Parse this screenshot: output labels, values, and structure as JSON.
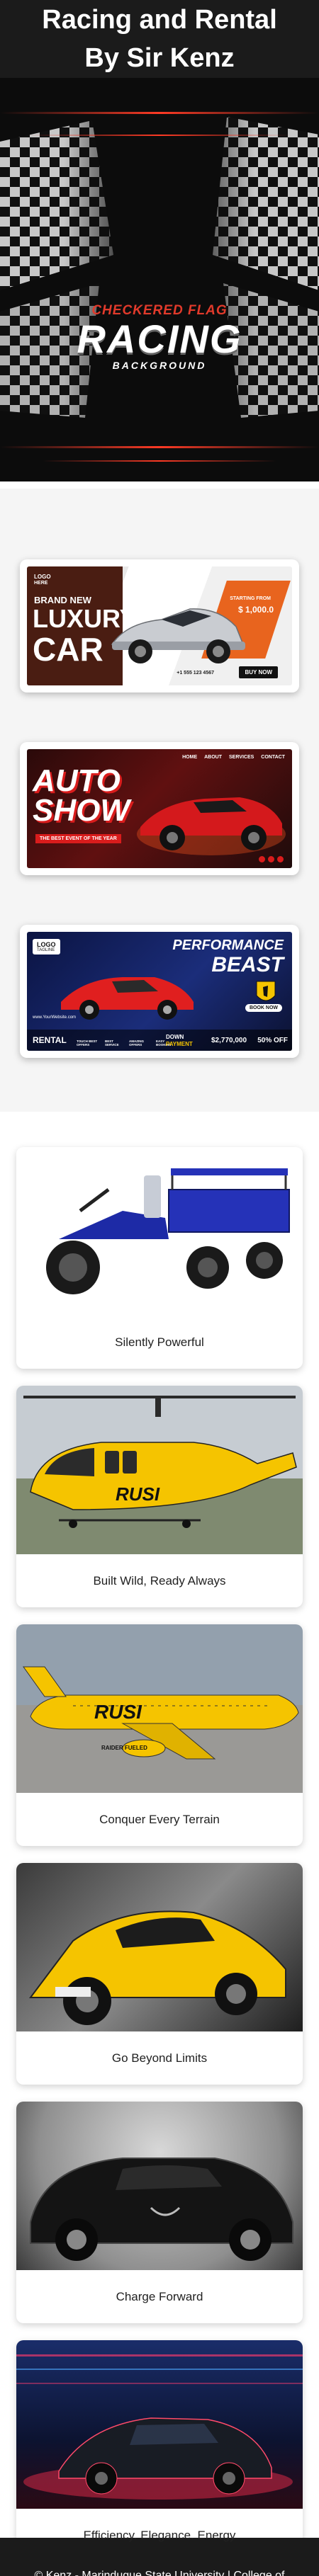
{
  "header": {
    "line1": "Racing and Rental",
    "line2": "By Sir Kenz"
  },
  "hero": {
    "top": "CHECKERED FLAG",
    "main": "RACING",
    "sub": "BACKGROUND"
  },
  "banners": [
    {
      "logo": "LOGO",
      "logo_sub": "HERE",
      "title_small": "BRAND NEW",
      "title_big1": "LUXURY",
      "title_big2": "CAR",
      "price_label": "STARTING FROM",
      "price": "$ 1,000.0",
      "phone": "+1 555 123 4567",
      "button": "BUY NOW"
    },
    {
      "title1": "AUTO",
      "title2": "SHOW",
      "tagline": "THE BEST EVENT OF THE YEAR",
      "menu": [
        "HOME",
        "ABOUT",
        "SERVICES",
        "CONTACT"
      ]
    },
    {
      "logo": "LOGO",
      "logo_sub": "TAGLINE",
      "title1": "PERFORMANCE",
      "title2": "BEAST",
      "button": "BOOK NOW",
      "website": "www.YourWebsite.com",
      "rental": "RENTAL",
      "specs": [
        "TOUCH BEST OFFERS",
        "BEST SERVICE",
        "AMAZING OFFERS",
        "EASY BOOKING"
      ],
      "down": "DOWN",
      "payment": "PAYMENT",
      "price": "$2,770,000",
      "discount": "50% OFF"
    }
  ],
  "gallery": [
    {
      "caption": "Silently Powerful",
      "subject": "motorcycle-cargo-trike"
    },
    {
      "caption": "Built Wild, Ready Always",
      "subject": "yellow-helicopter",
      "livery": "RUSI"
    },
    {
      "caption": "Conquer Every Terrain",
      "subject": "yellow-airplane",
      "livery": "RUSI",
      "sublivery": "RAIDER FUELED"
    },
    {
      "caption": "Go Beyond Limits",
      "subject": "yellow-supercar"
    },
    {
      "caption": "Charge Forward",
      "subject": "black-hypercar"
    },
    {
      "caption": "Efficiency. Elegance. Energy",
      "subject": "neon-sports-car"
    }
  ],
  "footer": {
    "text": "© Kenz - Marinduque State University | College of Information & Computing Science"
  },
  "colors": {
    "dark": "#1b1b1b",
    "accent_red": "#e23a2b",
    "rusi_yellow": "#f5c400"
  }
}
